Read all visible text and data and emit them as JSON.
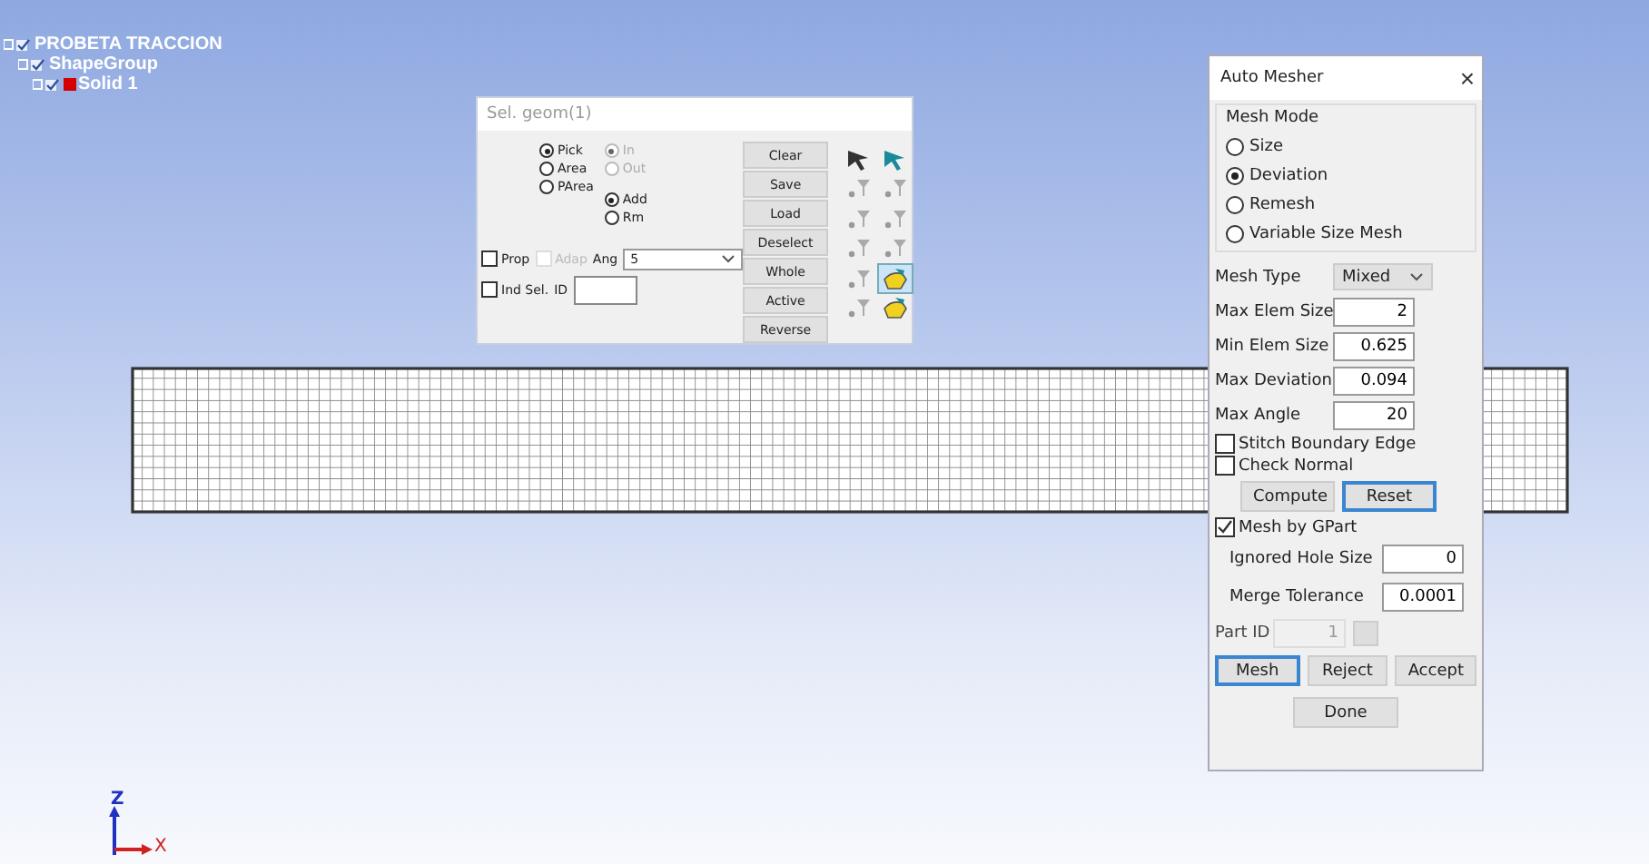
{
  "tree": [
    {
      "label": "PROBETA TRACCION",
      "children": [
        {
          "label": "ShapeGroup",
          "children": [
            {
              "label": "Solid 1",
              "color": "#d40000"
            }
          ]
        }
      ]
    }
  ],
  "sel_geom": {
    "title": "Sel. geom(1)",
    "pick_modes": [
      {
        "label": "Pick",
        "selected": true
      },
      {
        "label": "Area",
        "selected": false
      },
      {
        "label": "PArea",
        "selected": false
      }
    ],
    "in_out": [
      {
        "label": "In",
        "selected": true,
        "disabled": true
      },
      {
        "label": "Out",
        "selected": false,
        "disabled": true
      }
    ],
    "add_rm": [
      {
        "label": "Add",
        "selected": true
      },
      {
        "label": "Rm",
        "selected": false
      }
    ],
    "prop": {
      "label": "Prop",
      "checked": false
    },
    "adap": {
      "label": "Adap",
      "checked": false,
      "disabled": true
    },
    "ang": {
      "label": "Ang",
      "value": "5"
    },
    "ind_sel": {
      "label": "Ind Sel.",
      "checked": false
    },
    "id": {
      "label": "ID"
    },
    "buttons": [
      "Clear",
      "Save",
      "Load",
      "Deselect",
      "Whole",
      "Active",
      "Reverse"
    ],
    "tools": [
      {
        "kind": "cursor",
        "selected": false
      },
      {
        "kind": "cursor",
        "selected": false
      },
      {
        "kind": "filter",
        "selected": false
      },
      {
        "kind": "filter",
        "selected": false
      },
      {
        "kind": "filter",
        "selected": false
      },
      {
        "kind": "filter",
        "selected": false
      },
      {
        "kind": "filter",
        "selected": false
      },
      {
        "kind": "filter",
        "selected": false
      },
      {
        "kind": "filter",
        "selected": false
      },
      {
        "kind": "hand",
        "selected": true
      },
      {
        "kind": "filter",
        "selected": false
      },
      {
        "kind": "hand",
        "selected": false
      }
    ]
  },
  "auto_mesher": {
    "title": "Auto Mesher",
    "close": "×",
    "mesh_mode": {
      "title": "Mesh Mode",
      "options": [
        {
          "label": "Size",
          "selected": false
        },
        {
          "label": "Deviation",
          "selected": true
        },
        {
          "label": "Remesh",
          "selected": false
        },
        {
          "label": "Variable Size Mesh",
          "selected": false
        }
      ]
    },
    "mesh_type": {
      "label": "Mesh Type",
      "value": "Mixed"
    },
    "fields": [
      {
        "label": "Max Elem Size",
        "value": "2"
      },
      {
        "label": "Min Elem Size",
        "value": "0.625"
      },
      {
        "label": "Max Deviation",
        "value": "0.094"
      },
      {
        "label": "Max Angle",
        "value": "20"
      }
    ],
    "checks": [
      {
        "label": "Stitch Boundary Edge",
        "checked": false
      },
      {
        "label": "Check Normal",
        "checked": false
      }
    ],
    "row_buttons": [
      {
        "label": "Compute",
        "focused": false
      },
      {
        "label": "Reset",
        "focused": true
      }
    ],
    "mesh_by_gpart": {
      "label": "Mesh by GPart",
      "checked": true
    },
    "gpart_fields": [
      {
        "label": "Ignored Hole Size",
        "value": "0"
      },
      {
        "label": "Merge Tolerance",
        "value": "0.0001"
      }
    ],
    "part_id": {
      "label": "Part ID",
      "value": "1",
      "disabled": true
    },
    "action_buttons": [
      {
        "label": "Mesh",
        "focused": true
      },
      {
        "label": "Reject",
        "focused": false
      },
      {
        "label": "Accept",
        "focused": false
      }
    ],
    "done": "Done"
  },
  "axes": {
    "z": "Z",
    "x": "X"
  }
}
